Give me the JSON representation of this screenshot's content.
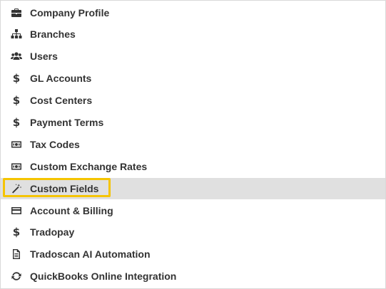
{
  "menu": {
    "items": [
      {
        "label": "Company Profile",
        "icon": "briefcase-icon"
      },
      {
        "label": "Branches",
        "icon": "sitemap-icon"
      },
      {
        "label": "Users",
        "icon": "users-icon"
      },
      {
        "label": "GL Accounts",
        "icon": "dollar-icon"
      },
      {
        "label": "Cost Centers",
        "icon": "dollar-icon"
      },
      {
        "label": "Payment Terms",
        "icon": "dollar-icon"
      },
      {
        "label": "Tax Codes",
        "icon": "banknote-icon"
      },
      {
        "label": "Custom Exchange Rates",
        "icon": "banknote-icon"
      },
      {
        "label": "Custom Fields",
        "icon": "magic-wand-icon",
        "active": true
      },
      {
        "label": "Account & Billing",
        "icon": "credit-card-icon"
      },
      {
        "label": "Tradopay",
        "icon": "dollar-icon"
      },
      {
        "label": "Tradoscan AI Automation",
        "icon": "document-icon"
      },
      {
        "label": "QuickBooks Online Integration",
        "icon": "sync-icon"
      }
    ],
    "dollar_glyph": "$"
  },
  "colors": {
    "text": "#333333",
    "active_background": "#e0e0e0",
    "highlight_border": "#f5c400",
    "panel_border": "#d9d9d9"
  }
}
